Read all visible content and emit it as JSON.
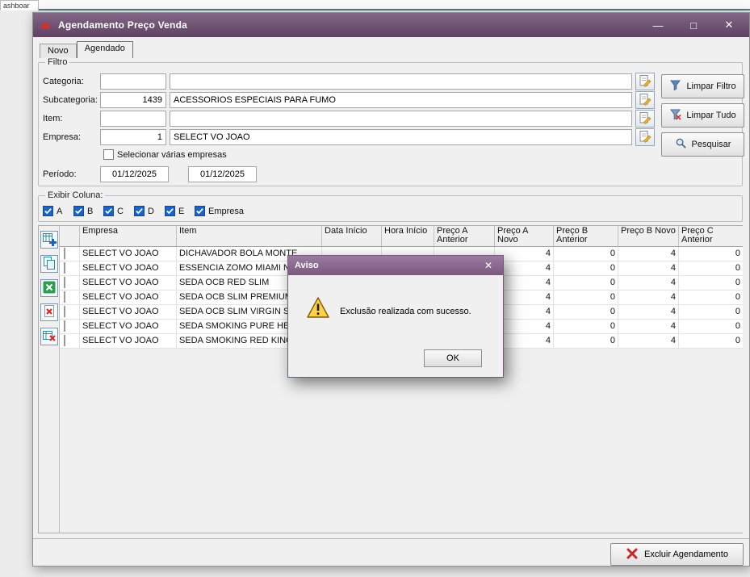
{
  "colors": {
    "titlebar": "#6e4d72",
    "dialog_titlebar": "#8a6590",
    "accent_blue": "#1a62c5",
    "danger_red": "#d42a2a",
    "warning_yellow": "#ffd24a"
  },
  "browser": {
    "tab_label": "ashboar"
  },
  "window": {
    "title": "Agendamento Preço Venda",
    "minimize_glyph": "—",
    "maximize_glyph": "□",
    "close_glyph": "✕"
  },
  "tabs": {
    "novo": "Novo",
    "agendado": "Agendado"
  },
  "filter": {
    "group_label": "Filtro",
    "rows": [
      {
        "label": "Categoria:",
        "code": "",
        "text": ""
      },
      {
        "label": "Subcategoria:",
        "code": "1439",
        "text": "ACESSORIOS ESPECIAIS PARA FUMO"
      },
      {
        "label": "Item:",
        "code": "",
        "text": ""
      },
      {
        "label": "Empresa:",
        "code": "1",
        "text": "SELECT VO JOAO"
      }
    ],
    "multi_company_label": "Selecionar várias empresas",
    "period_label": "Período:",
    "period_start": "01/12/2025",
    "period_end": "01/12/2025",
    "btn_limpar_filtro": "Limpar Filtro",
    "btn_limpar_tudo": "Limpar Tudo",
    "btn_pesquisar": "Pesquisar"
  },
  "columns_box": {
    "group_label": "Exibir Coluna:",
    "options": [
      {
        "label": "A",
        "checked": true
      },
      {
        "label": "B",
        "checked": true
      },
      {
        "label": "C",
        "checked": true
      },
      {
        "label": "D",
        "checked": true
      },
      {
        "label": "E",
        "checked": true
      },
      {
        "label": "Empresa",
        "checked": true
      }
    ]
  },
  "grid": {
    "headers": [
      "",
      "Empresa",
      "Item",
      "Data Início",
      "Hora Início",
      "Preço A Anterior",
      "Preço A Novo",
      "Preço B Anterior",
      "Preço B Novo",
      "Preço C Anterior"
    ],
    "rows": [
      {
        "empresa": "SELECT VO JOAO",
        "item": "DICHAVADOR BOLA MONTE",
        "data_inicio": "",
        "hora_inicio": "",
        "preco_a_ant": "",
        "preco_a_novo": "4",
        "preco_b_ant": "0",
        "preco_b_novo": "4",
        "preco_c_ant": "0"
      },
      {
        "empresa": "SELECT VO JOAO",
        "item": "ESSENCIA ZOMO MIAMI NIG",
        "data_inicio": "",
        "hora_inicio": "",
        "preco_a_ant": "",
        "preco_a_novo": "4",
        "preco_b_ant": "0",
        "preco_b_novo": "4",
        "preco_c_ant": "0"
      },
      {
        "empresa": "SELECT VO JOAO",
        "item": "SEDA OCB RED SLIM",
        "data_inicio": "",
        "hora_inicio": "",
        "preco_a_ant": "",
        "preco_a_novo": "4",
        "preco_b_ant": "0",
        "preco_b_novo": "4",
        "preco_c_ant": "0"
      },
      {
        "empresa": "SELECT VO JOAO",
        "item": "SEDA OCB SLIM PREMIUM E",
        "data_inicio": "",
        "hora_inicio": "",
        "preco_a_ant": "",
        "preco_a_novo": "4",
        "preco_b_ant": "0",
        "preco_b_novo": "4",
        "preco_c_ant": "0"
      },
      {
        "empresa": "SELECT VO JOAO",
        "item": "SEDA OCB SLIM VIRGIN SLIM",
        "data_inicio": "",
        "hora_inicio": "",
        "preco_a_ant": "",
        "preco_a_novo": "4",
        "preco_b_ant": "0",
        "preco_b_novo": "4",
        "preco_c_ant": "0"
      },
      {
        "empresa": "SELECT VO JOAO",
        "item": "SEDA SMOKING PURE HEMP",
        "data_inicio": "",
        "hora_inicio": "",
        "preco_a_ant": "",
        "preco_a_novo": "4",
        "preco_b_ant": "0",
        "preco_b_novo": "4",
        "preco_c_ant": "0"
      },
      {
        "empresa": "SELECT VO JOAO",
        "item": "SEDA SMOKING RED KING SI",
        "data_inicio": "",
        "hora_inicio": "",
        "preco_a_ant": "",
        "preco_a_novo": "4",
        "preco_b_ant": "0",
        "preco_b_novo": "4",
        "preco_c_ant": "0"
      }
    ]
  },
  "dialog": {
    "title": "Aviso",
    "close_glyph": "✕",
    "message": "Exclusão realizada com sucesso.",
    "ok_label": "OK"
  },
  "footer": {
    "excluir_label": "Excluir Agendamento"
  }
}
